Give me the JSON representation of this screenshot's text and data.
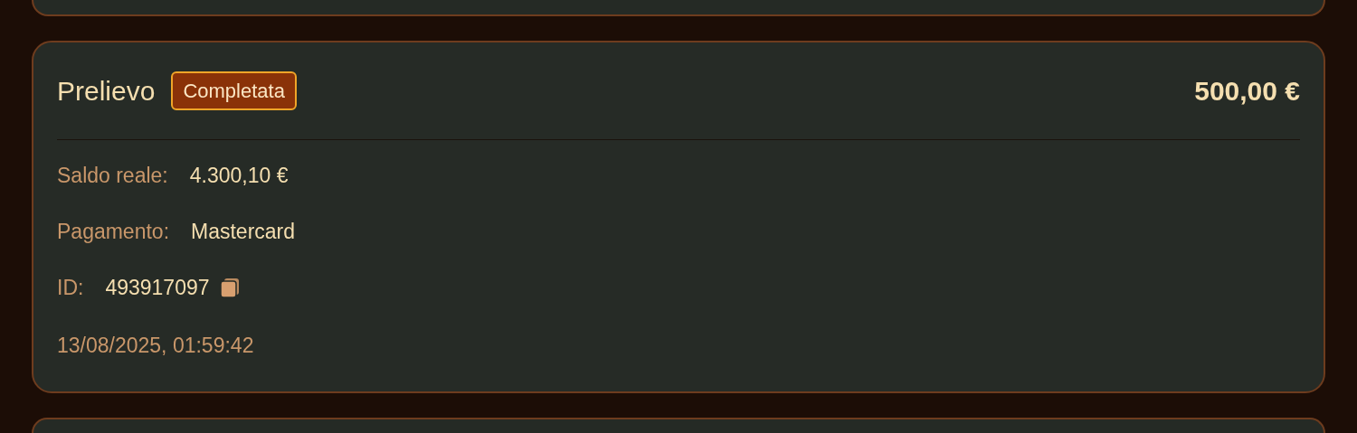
{
  "transaction": {
    "type": "Prelievo",
    "status": {
      "label": "Completata",
      "kind": "completed"
    },
    "amount": "500,00 €",
    "details": [
      {
        "label": "Saldo reale:",
        "value": "4.300,10 €",
        "copyable": false
      },
      {
        "label": "Pagamento:",
        "value": "Mastercard",
        "copyable": false
      },
      {
        "label": "ID:",
        "value": "493917097",
        "copyable": true
      }
    ],
    "timestamp": "13/08/2025, 01:59:42"
  }
}
